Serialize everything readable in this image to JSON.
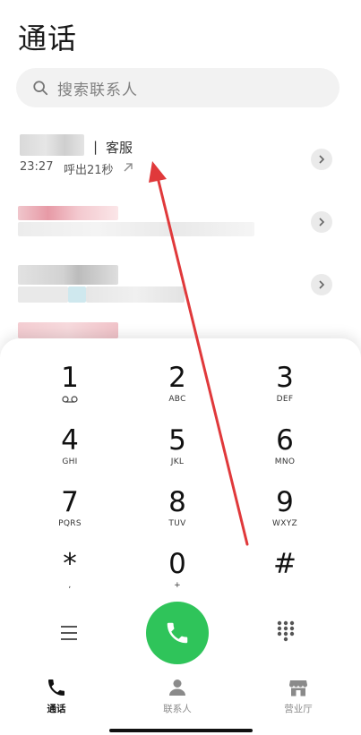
{
  "header": {
    "title": "通话"
  },
  "search": {
    "placeholder": "搜索联系人"
  },
  "recent_calls": [
    {
      "name_label": "客服",
      "separator": "|",
      "time": "23:27",
      "description": "呼出21秒"
    }
  ],
  "dialpad": {
    "keys": [
      {
        "digit": "1",
        "letters": ""
      },
      {
        "digit": "2",
        "letters": "ABC"
      },
      {
        "digit": "3",
        "letters": "DEF"
      },
      {
        "digit": "4",
        "letters": "GHI"
      },
      {
        "digit": "5",
        "letters": "JKL"
      },
      {
        "digit": "6",
        "letters": "MNO"
      },
      {
        "digit": "7",
        "letters": "PQRS"
      },
      {
        "digit": "8",
        "letters": "TUV"
      },
      {
        "digit": "9",
        "letters": "WXYZ"
      },
      {
        "digit": "*",
        "letters": ","
      },
      {
        "digit": "0",
        "letters": "+"
      },
      {
        "digit": "#",
        "letters": ""
      }
    ]
  },
  "tabs": [
    {
      "label": "通话",
      "icon": "phone-icon",
      "active": true
    },
    {
      "label": "联系人",
      "icon": "person-icon",
      "active": false
    },
    {
      "label": "营业厅",
      "icon": "store-icon",
      "active": false
    }
  ],
  "colors": {
    "call_button": "#2fc45a",
    "annotation_arrow": "#e0393b",
    "search_bg": "#f2f2f2"
  }
}
